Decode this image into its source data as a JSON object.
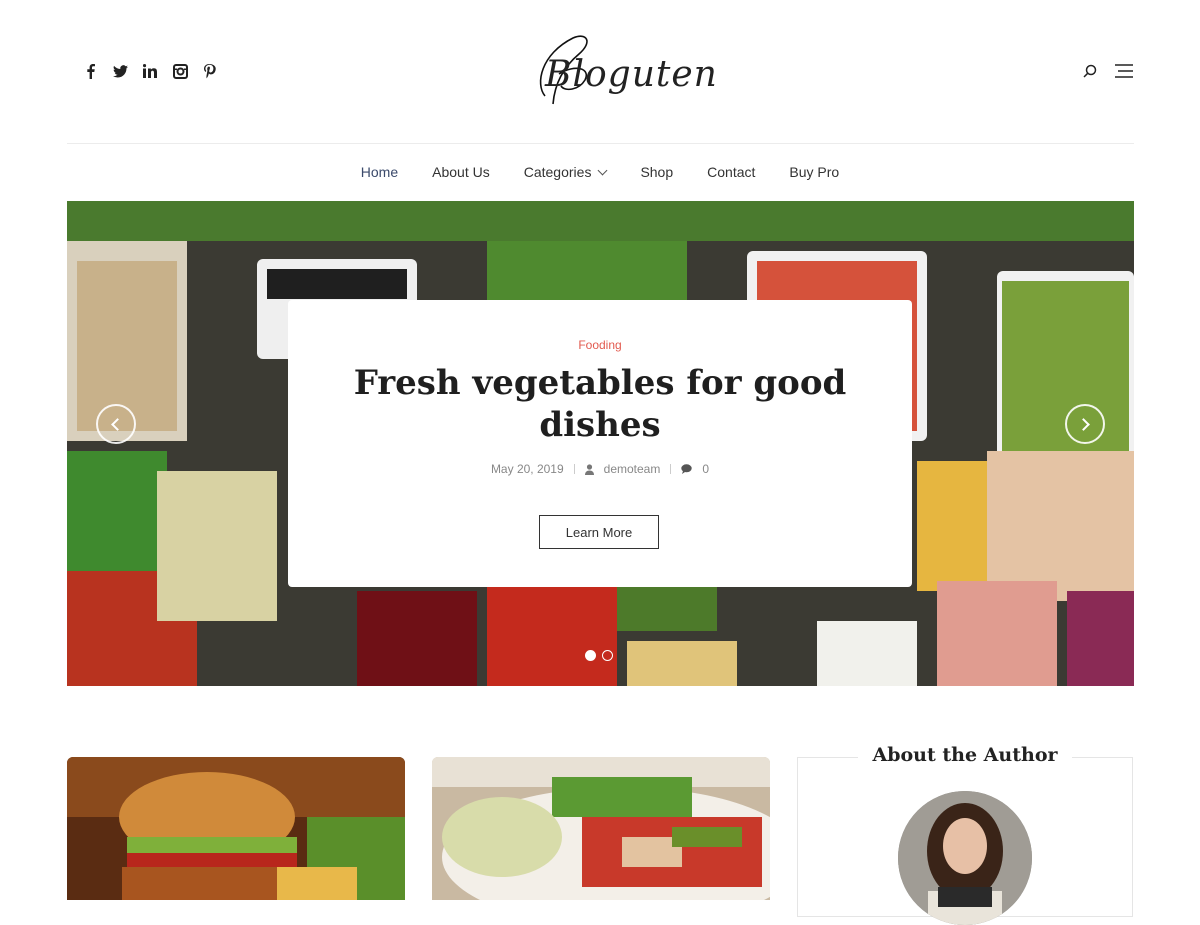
{
  "header": {
    "logo_text": "Bloguten",
    "social": [
      "facebook-icon",
      "twitter-icon",
      "linkedin-icon",
      "instagram-icon",
      "pinterest-icon"
    ],
    "tools": [
      "search-icon",
      "menu-icon"
    ]
  },
  "nav": {
    "items": [
      {
        "label": "Home",
        "active": true
      },
      {
        "label": "About Us"
      },
      {
        "label": "Categories",
        "dropdown": true
      },
      {
        "label": "Shop"
      },
      {
        "label": "Contact"
      },
      {
        "label": "Buy Pro"
      }
    ]
  },
  "hero": {
    "category": "Fooding",
    "title": "Fresh vegetables for good dishes",
    "date": "May 20, 2019",
    "author": "demoteam",
    "comments": "0",
    "button_label": "Learn More",
    "slides": 2,
    "active_slide": 1,
    "accent_color": "#e25a4f"
  },
  "sidebar": {
    "author_title": "About the Author"
  }
}
